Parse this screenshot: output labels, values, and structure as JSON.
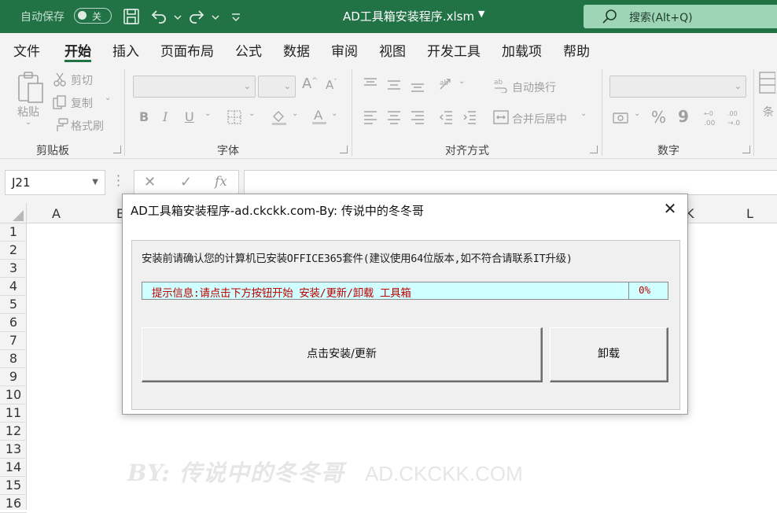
{
  "titlebar": {
    "autosave_label": "自动保存",
    "autosave_state": "关",
    "document_title": "AD工具箱安装程序.xlsm",
    "search_placeholder": "搜索(Alt+Q)"
  },
  "tabs": [
    "文件",
    "开始",
    "插入",
    "页面布局",
    "公式",
    "数据",
    "审阅",
    "视图",
    "开发工具",
    "加载项",
    "帮助"
  ],
  "active_tab": "开始",
  "ribbon": {
    "clipboard": {
      "paste": "粘贴",
      "cut": "剪切",
      "copy": "复制",
      "format_painter": "格式刷",
      "group_label": "剪贴板"
    },
    "font": {
      "bold": "B",
      "italic": "I",
      "underline": "U",
      "group_label": "字体"
    },
    "alignment": {
      "wrap_text": "自动换行",
      "merge_center": "合并后居中",
      "group_label": "对齐方式"
    },
    "number": {
      "group_label": "数字",
      "percent": "%",
      "comma": "9"
    },
    "styles": {
      "conditional_cut": "条"
    }
  },
  "formula_bar": {
    "name_box": "J21",
    "fx": "fx",
    "cancel": "✕",
    "enter": "✓",
    "formula": ""
  },
  "grid": {
    "columns": [
      "A",
      "B",
      "K",
      "L"
    ],
    "rows": [
      "1",
      "2",
      "3",
      "4",
      "5",
      "6",
      "7",
      "8",
      "9",
      "10",
      "11",
      "12",
      "13",
      "14",
      "15",
      "16"
    ]
  },
  "watermark": {
    "author": "BY: 传说中的冬冬哥",
    "site": "AD.CKCKK.COM"
  },
  "dialog": {
    "title": "AD工具箱安装程序-ad.ckckk.com-By: 传说中的冬冬哥",
    "notice": "安装前请确认您的计算机已安装OFFICE365套件(建议使用64位版本,如不符合请联系IT升级)",
    "status_message": "提示信息:请点击下方按钮开始 安装/更新/卸载 工具箱",
    "progress_text": "0%",
    "progress_value": 0,
    "install_button": "点击安装/更新",
    "uninstall_button": "卸载"
  },
  "colors": {
    "excel_green": "#217346",
    "progress_bg": "#cfffff",
    "status_text": "#c00000"
  }
}
